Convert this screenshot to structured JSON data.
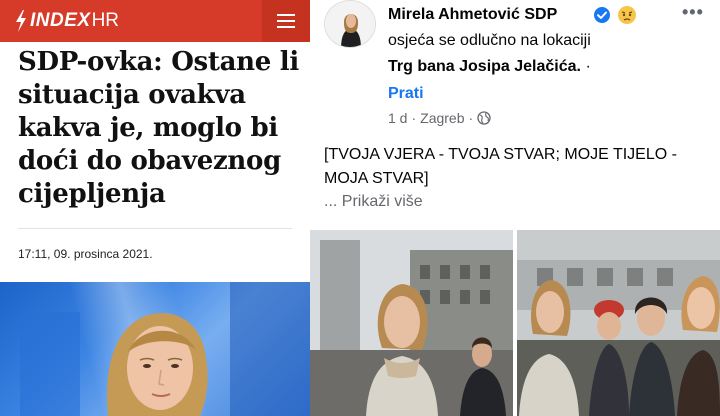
{
  "index_article": {
    "brand": "INDEX",
    "brand_suffix": "HR",
    "headline": "SDP-ovka: Ostane li situacija ovakva kakva je, moglo bi doći do obaveznog cijepljenja",
    "date": "17:11, 09. prosinca 2021.",
    "colors": {
      "header": "#d63b2a",
      "menu_button": "#c5321f"
    },
    "icons": {
      "logo": "lightning-bolt-icon",
      "menu": "hamburger-menu-icon"
    }
  },
  "facebook_post": {
    "author": "Mirela Ahmetović SDP",
    "feeling": "osjeća se odlučno na lokaciji",
    "location": "Trg bana Josipa Jelačića.",
    "location_separator": "·",
    "follow_label": "Prati",
    "time": "1 d",
    "separator": "·",
    "city": "Zagreb",
    "text": "[TVOJA VJERA - TVOJA STVAR; MOJE TIJELO - MOJA STVAR]",
    "see_more": "... Prikaži više",
    "more_menu": "•••",
    "colors": {
      "link": "#1877f2",
      "verified": "#1877f2",
      "meta": "#65676b"
    },
    "icons": {
      "verified": "verified-badge-icon",
      "feeling": "determined-face-emoji",
      "privacy": "globe-icon",
      "more": "more-options-icon"
    }
  }
}
